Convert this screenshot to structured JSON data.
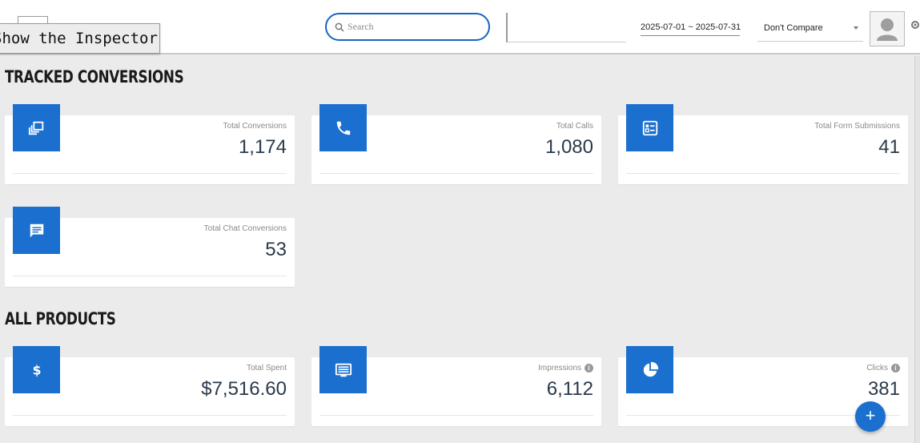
{
  "header": {
    "inspector_label": "Show the Inspector",
    "search_placeholder": "Search",
    "date_range": "2025-07-01 ~ 2025-07-31",
    "compare_selected": "Don't Compare"
  },
  "sections": {
    "tracked_title": "TRACKED CONVERSIONS",
    "products_title": "ALL PRODUCTS"
  },
  "tracked_cards": [
    {
      "label": "Total Conversions",
      "value": "1,174",
      "icon": "conversions-icon"
    },
    {
      "label": "Total Calls",
      "value": "1,080",
      "icon": "phone-icon"
    },
    {
      "label": "Total Form Submissions",
      "value": "41",
      "icon": "form-icon"
    },
    {
      "label": "Total Chat Conversions",
      "value": "53",
      "icon": "chat-icon"
    }
  ],
  "product_cards": [
    {
      "label": "Total Spent",
      "value": "$7,516.60",
      "icon": "dollar-icon"
    },
    {
      "label": "Impressions",
      "value": "6,112",
      "icon": "impressions-icon",
      "info": "i"
    },
    {
      "label": "Clicks",
      "value": "381",
      "icon": "pie-chart-icon",
      "info": "i"
    }
  ],
  "fab_label": "+",
  "colors": {
    "accent": "#1a6fcf",
    "background": "#ebebeb",
    "search_border": "#1565c0"
  }
}
